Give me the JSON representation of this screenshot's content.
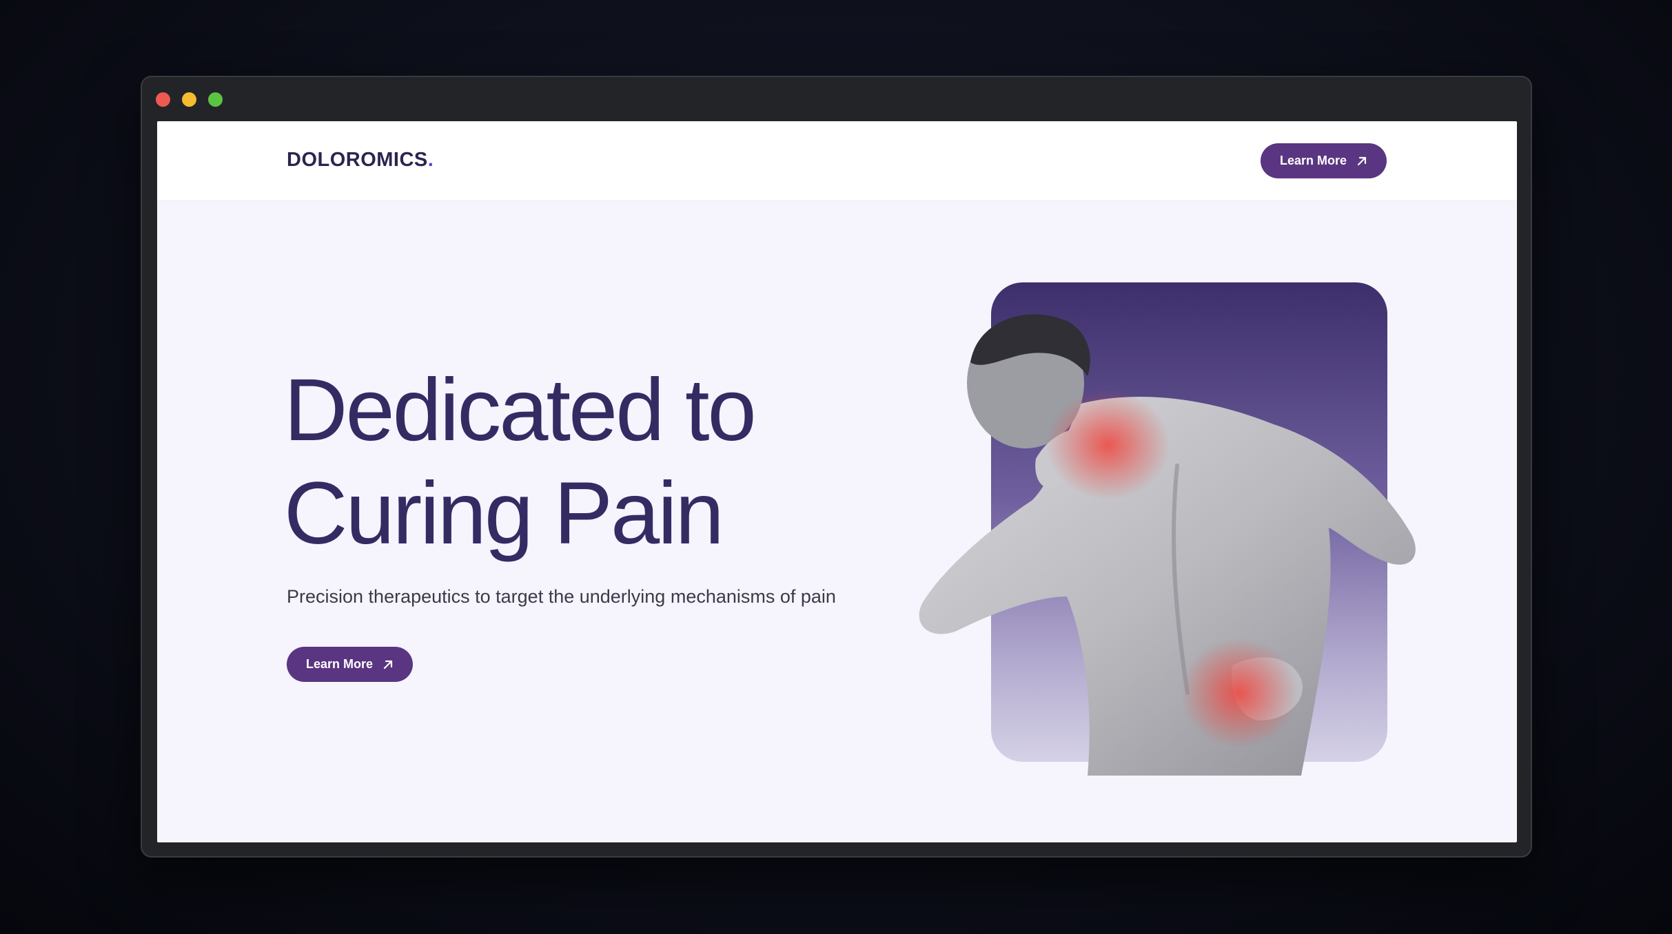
{
  "window": {
    "controls": [
      "close",
      "minimize",
      "maximize"
    ]
  },
  "nav": {
    "logo_text": "DOLOROMICS",
    "logo_dot": ".",
    "cta_label": "Learn More",
    "cta_icon": "arrow-up-right-icon"
  },
  "hero": {
    "headline_line1": "Dedicated to",
    "headline_line2": "Curing Pain",
    "subtext": "Precision therapeutics to target the underlying mechanisms of pain",
    "cta_label": "Learn More",
    "cta_icon": "arrow-up-right-icon",
    "image_alt": "man-holding-neck-and-lower-back-in-pain"
  },
  "colors": {
    "brand": "#5a3581",
    "headline": "#352b63",
    "accent_dot": "#4b43e0",
    "pain_highlight": "#e8433f"
  }
}
